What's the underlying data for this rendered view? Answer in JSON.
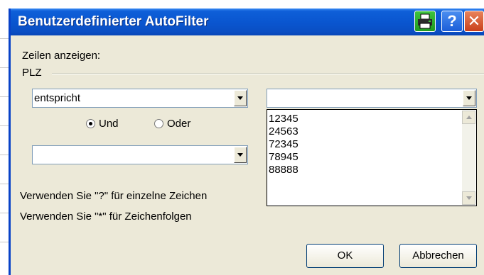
{
  "dialog": {
    "title": "Benutzerdefinierter AutoFilter",
    "show_rows_label": "Zeilen anzeigen:",
    "field_name": "PLZ",
    "condition1": {
      "operator": "entspricht",
      "value": ""
    },
    "join": {
      "and_label": "Und",
      "or_label": "Oder",
      "selected": "Und"
    },
    "condition2": {
      "operator": "",
      "value": ""
    },
    "value_list": [
      "12345",
      "24563",
      "72345",
      "78945",
      "88888"
    ],
    "hint1": "Verwenden Sie \"?\" für einzelne Zeichen",
    "hint2": "Verwenden Sie \"*\" für Zeichenfolgen",
    "ok_label": "OK",
    "cancel_label": "Abbrechen"
  },
  "titlebar_buttons": {
    "help_glyph": "?",
    "close_glyph": "✕"
  },
  "icons": [
    "printer-icon",
    "help-icon",
    "close-icon",
    "dropdown-arrow-icon",
    "scroll-up-icon",
    "scroll-down-icon"
  ],
  "colors": {
    "title_bar": "#0a56d0",
    "dialog_bg": "#ece9d8",
    "print_button": "#2aa52a",
    "close_button": "#d9532f"
  }
}
